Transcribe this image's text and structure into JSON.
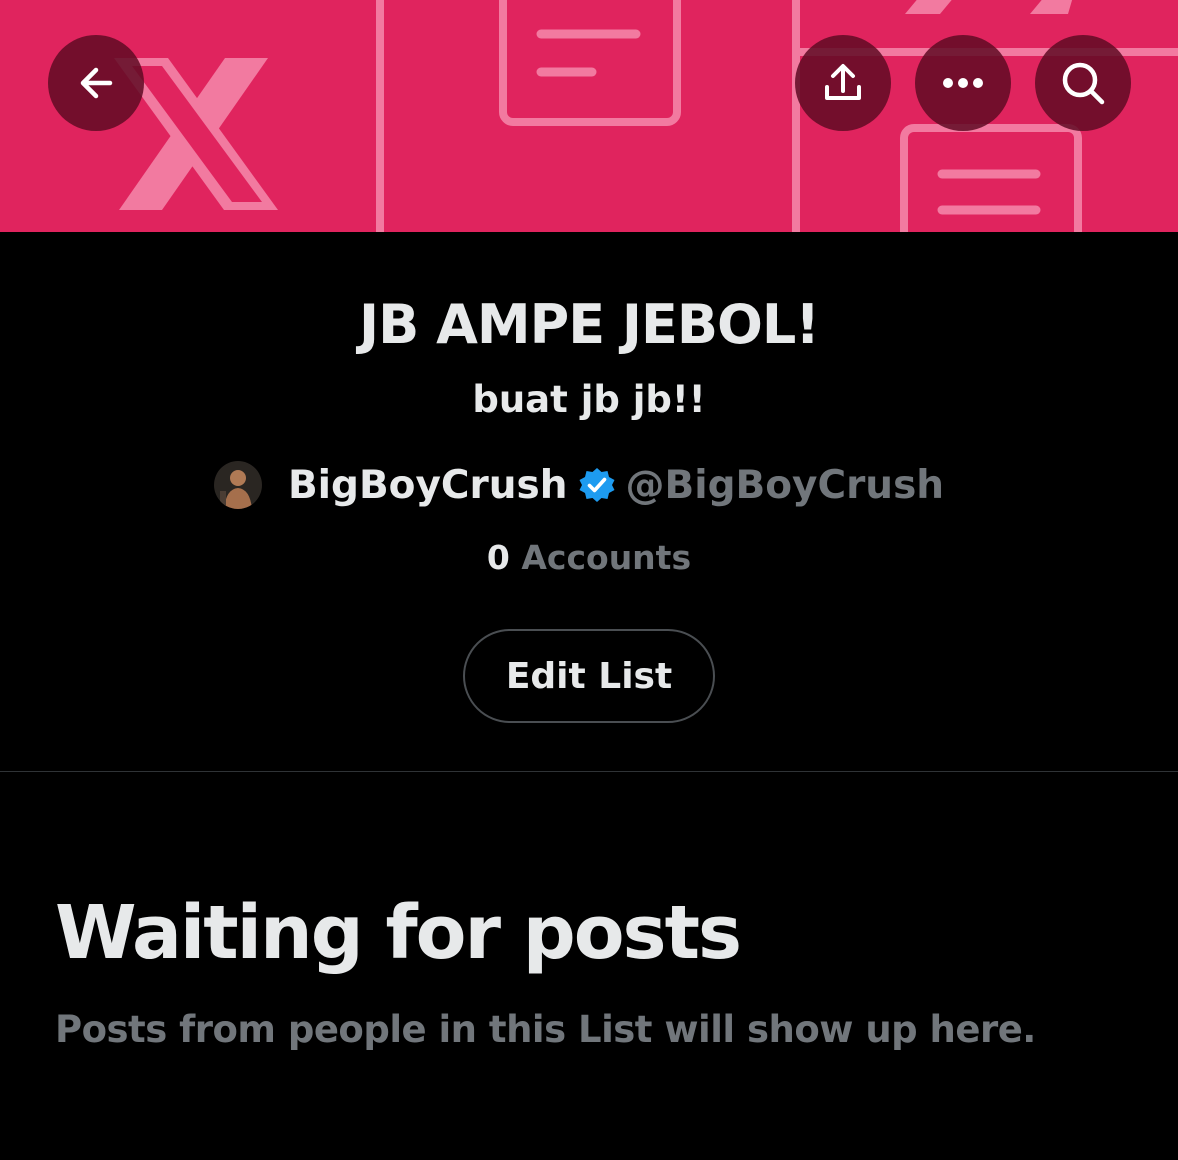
{
  "header": {
    "back_icon": "arrow-left-icon",
    "share_icon": "share-upload-icon",
    "more_icon": "ellipsis-icon",
    "search_icon": "search-icon",
    "banner_color": "#e0245e"
  },
  "list": {
    "title": "JB AMPE JEBOL!",
    "description": "buat jb jb!!",
    "owner": {
      "display_name": "BigBoyCrush",
      "handle": "@BigBoyCrush",
      "verified": true,
      "verified_color": "#1d9bf0"
    },
    "accounts_count": "0",
    "accounts_label": "Accounts",
    "edit_button_label": "Edit List"
  },
  "empty_state": {
    "title": "Waiting for posts",
    "subtitle": "Posts from people in this List will show up here."
  }
}
